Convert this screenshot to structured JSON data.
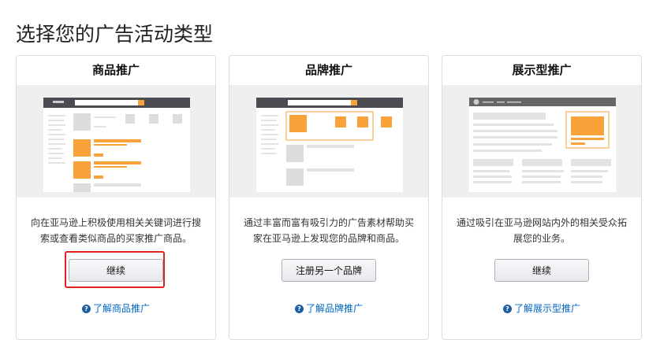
{
  "page_title": "选择您的广告活动类型",
  "cards": [
    {
      "title": "商品推广",
      "description": "向在亚马逊上积极使用相关关键词进行搜索或查看类似商品的买家推广商品。",
      "button": "继续",
      "learn_more": "了解商品推广"
    },
    {
      "title": "品牌推广",
      "description": "通过丰富而富有吸引力的广告素材帮助买家在亚马逊上发现您的品牌和商品。",
      "button": "注册另一个品牌",
      "learn_more": "了解品牌推广"
    },
    {
      "title": "展示型推广",
      "description": "通过吸引在亚马逊网站内外的相关受众拓展您的业务。",
      "button": "继续",
      "learn_more": "了解展示型推广"
    }
  ],
  "colors": {
    "accent": "#f9a23a",
    "highlight": "#e0241b",
    "link": "#0066c0"
  }
}
